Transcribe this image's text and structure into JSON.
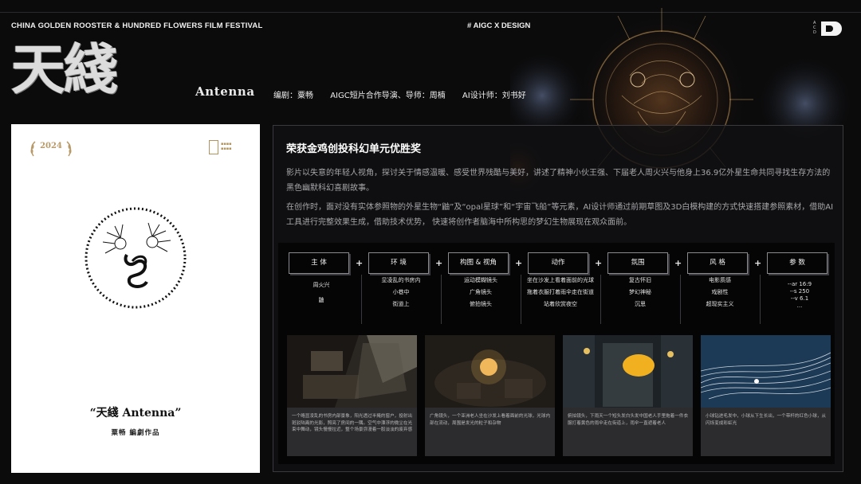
{
  "header": {
    "festival": "CHINA GOLDEN ROOSTER & HUNDRED FLOWERS FILM FESTIVAL",
    "tag": "# AIGC X DESIGN",
    "brand_letters": [
      "A",
      "C",
      "D"
    ],
    "title_cn": "天綫",
    "title_en": "Antenna",
    "credits": [
      "编剧：粟畅",
      "AIGC短片合作导演、导师：周楠",
      "AI设计师：刘书好"
    ]
  },
  "poster": {
    "year": "2024",
    "title": "“天綫 Antenna”",
    "subtitle": "粟畅 編劇作品"
  },
  "panel": {
    "award": "荣获金鸡创投科幻单元优胜奖",
    "desc1": "影片以失意的年轻人视角，探讨关于情感温暖、感受世界残酷与美好，讲述了精神小伙王强、下届老人周火兴与他身上36.9亿外星生命共同寻找生存方法的黑色幽默科幻喜剧故事。",
    "desc2": "在创作时，面对没有实体参照物的外星生物“鼬”及“opal星球”和“宇宙飞船”等元素，AI设计师通过前期草图及3D白模构建的方式快速搭建参照素材，借助AI工具进行完整效果生成，借助技术优势， 快速将创作者脑海中所构思的梦幻生物展现在观众面前。"
  },
  "flow": {
    "steps": [
      "主 体",
      "环 境",
      "构图 & 视角",
      "动作",
      "氛围",
      "风 格",
      "参 数"
    ],
    "plus": "+",
    "columns": [
      [
        "周火兴",
        "鼬"
      ],
      [
        "显凌乱的书房内",
        "小巷中",
        "街道上"
      ],
      [
        "运动模糊镜头",
        "广角镜头",
        "俯拍镜头"
      ],
      [
        "坐在沙发上看着面前的光球",
        "拖着衣服打着雨伞走在街道",
        "站着欣赏夜空"
      ],
      [
        "复古怀旧",
        "梦幻神秘",
        "沉思"
      ],
      [
        "电影质感",
        "戏剧性",
        "超现实主义"
      ],
      [
        "--ar 16:9",
        "--s 250",
        "--v 6.1",
        "..."
      ]
    ]
  },
  "thumbs": [
    "一个略显凌乱的书房内部景象，阳光透过半掩的窗户，投射出斑驳陆离的光影，照亮了房间的一隅。空气中漂浮的微尘在光束中舞动，镜头慢慢拉近，整个场景弥漫着一股淡淡的废弃感",
    "广角镜头，一个亚洲老人坐在沙发上看着面前的光球，光球内部在流动，周围是发光的粒子和杂物",
    "俯拍镜头，下雨天一个短头发白头发中国老人手里拖着一件衣服打着黄色的雨伞走在街道上，雨伞一直遮着老人",
    "小球钻进毛发中，小球从下生长出，一个带杆的红色小球，从闪烁变成彩虹光"
  ],
  "colors": {
    "background": "#0b0b0c",
    "panel_border": "#3a3a3e",
    "poster_gold": "#b0935e",
    "text_muted": "#a7a7ab"
  }
}
